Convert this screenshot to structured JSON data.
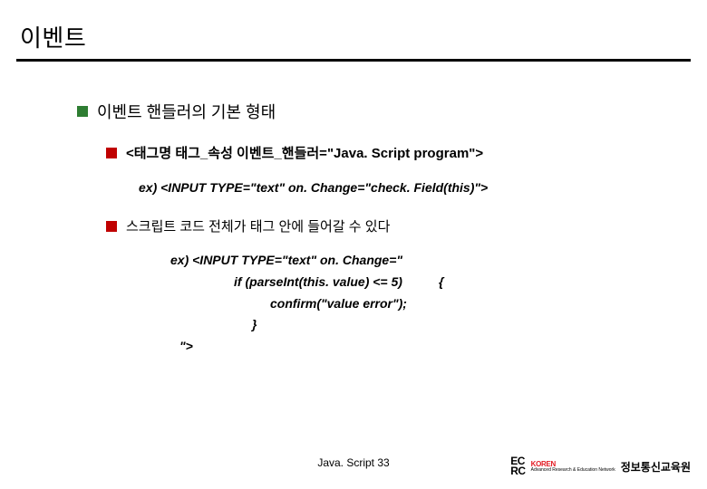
{
  "title": "이벤트",
  "level1": "이벤트 핸들러의 기본 형태",
  "level2a": "<태그명 태그_속성 이벤트_핸들러=\"Java. Script program\">",
  "ex1": "ex) <INPUT TYPE=\"text\" on. Change=\"check. Field(this)\">",
  "level2b": "스크립트 코드 전체가 태그 안에 들어갈 수 있다",
  "ex2_l1": "ex) <INPUT TYPE=\"text\" on. Change=\"",
  "ex2_l2a": "if (parseInt(this. value) <= 5)",
  "ex2_l2b": "{",
  "ex2_l3": "confirm(\"value error\");",
  "ex2_l4": "}",
  "ex2_l5": "\">",
  "footer_center": "Java. Script 33",
  "logo_r1": "EC",
  "logo_r2": "RC",
  "koren": "KOREN",
  "koren_sub": "Advanced Research &\nEducation Network",
  "footer_right": "정보통신교육원"
}
